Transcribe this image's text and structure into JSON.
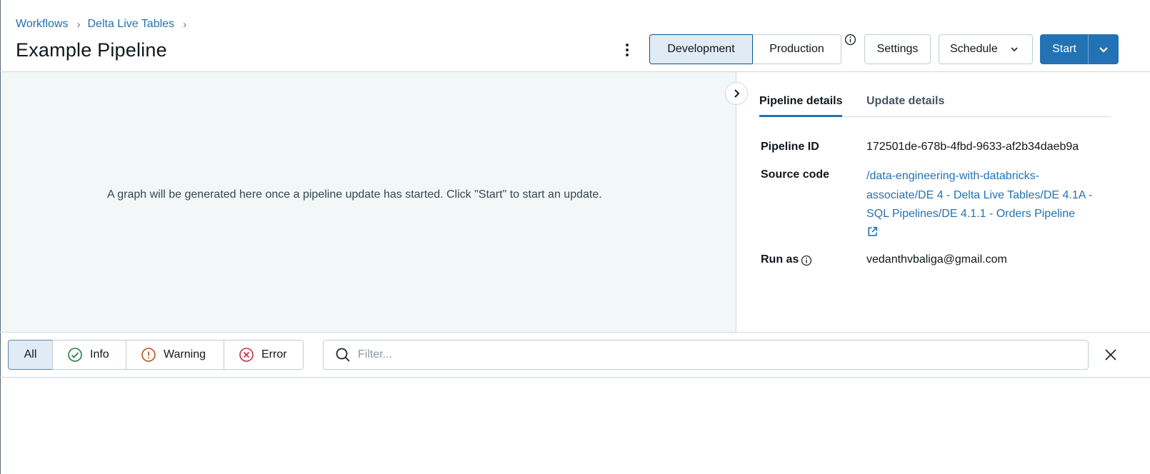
{
  "breadcrumb": {
    "items": [
      "Workflows",
      "Delta Live Tables"
    ],
    "separator": "›"
  },
  "page": {
    "title": "Example Pipeline"
  },
  "header": {
    "mode_toggle": {
      "development": "Development",
      "production": "Production",
      "selected": "Development"
    },
    "settings_label": "Settings",
    "schedule_label": "Schedule",
    "start_label": "Start",
    "icons": {
      "menu": "kebab-menu-icon",
      "info": "info-icon",
      "dropdown": "chevron-down-icon"
    }
  },
  "graph": {
    "empty_message": "A graph will be generated here once a pipeline update has started. Click \"Start\" to start an update."
  },
  "details": {
    "tabs": [
      "Pipeline details",
      "Update details"
    ],
    "active_tab": "Pipeline details",
    "pipeline_id_label": "Pipeline ID",
    "pipeline_id": "172501de-678b-4fbd-9633-af2b34daeb9a",
    "source_code_label": "Source code",
    "source_code_path": "/data-engineering-with-databricks-associate/DE 4 - Delta Live Tables/DE 4.1A - SQL Pipelines/DE 4.1.1 - Orders Pipeline",
    "run_as_label": "Run as",
    "run_as": "vedanthvbaliga@gmail.com"
  },
  "event_filter": {
    "levels": [
      "All",
      "Info",
      "Warning",
      "Error"
    ],
    "selected": "All",
    "search_placeholder": "Filter...",
    "search_value": ""
  },
  "colors": {
    "primary": "#2272b4",
    "info_green": "#277c43",
    "warning_orange": "#be501e",
    "error_red": "#c82d4c",
    "graph_bg": "#f2f7f7"
  }
}
